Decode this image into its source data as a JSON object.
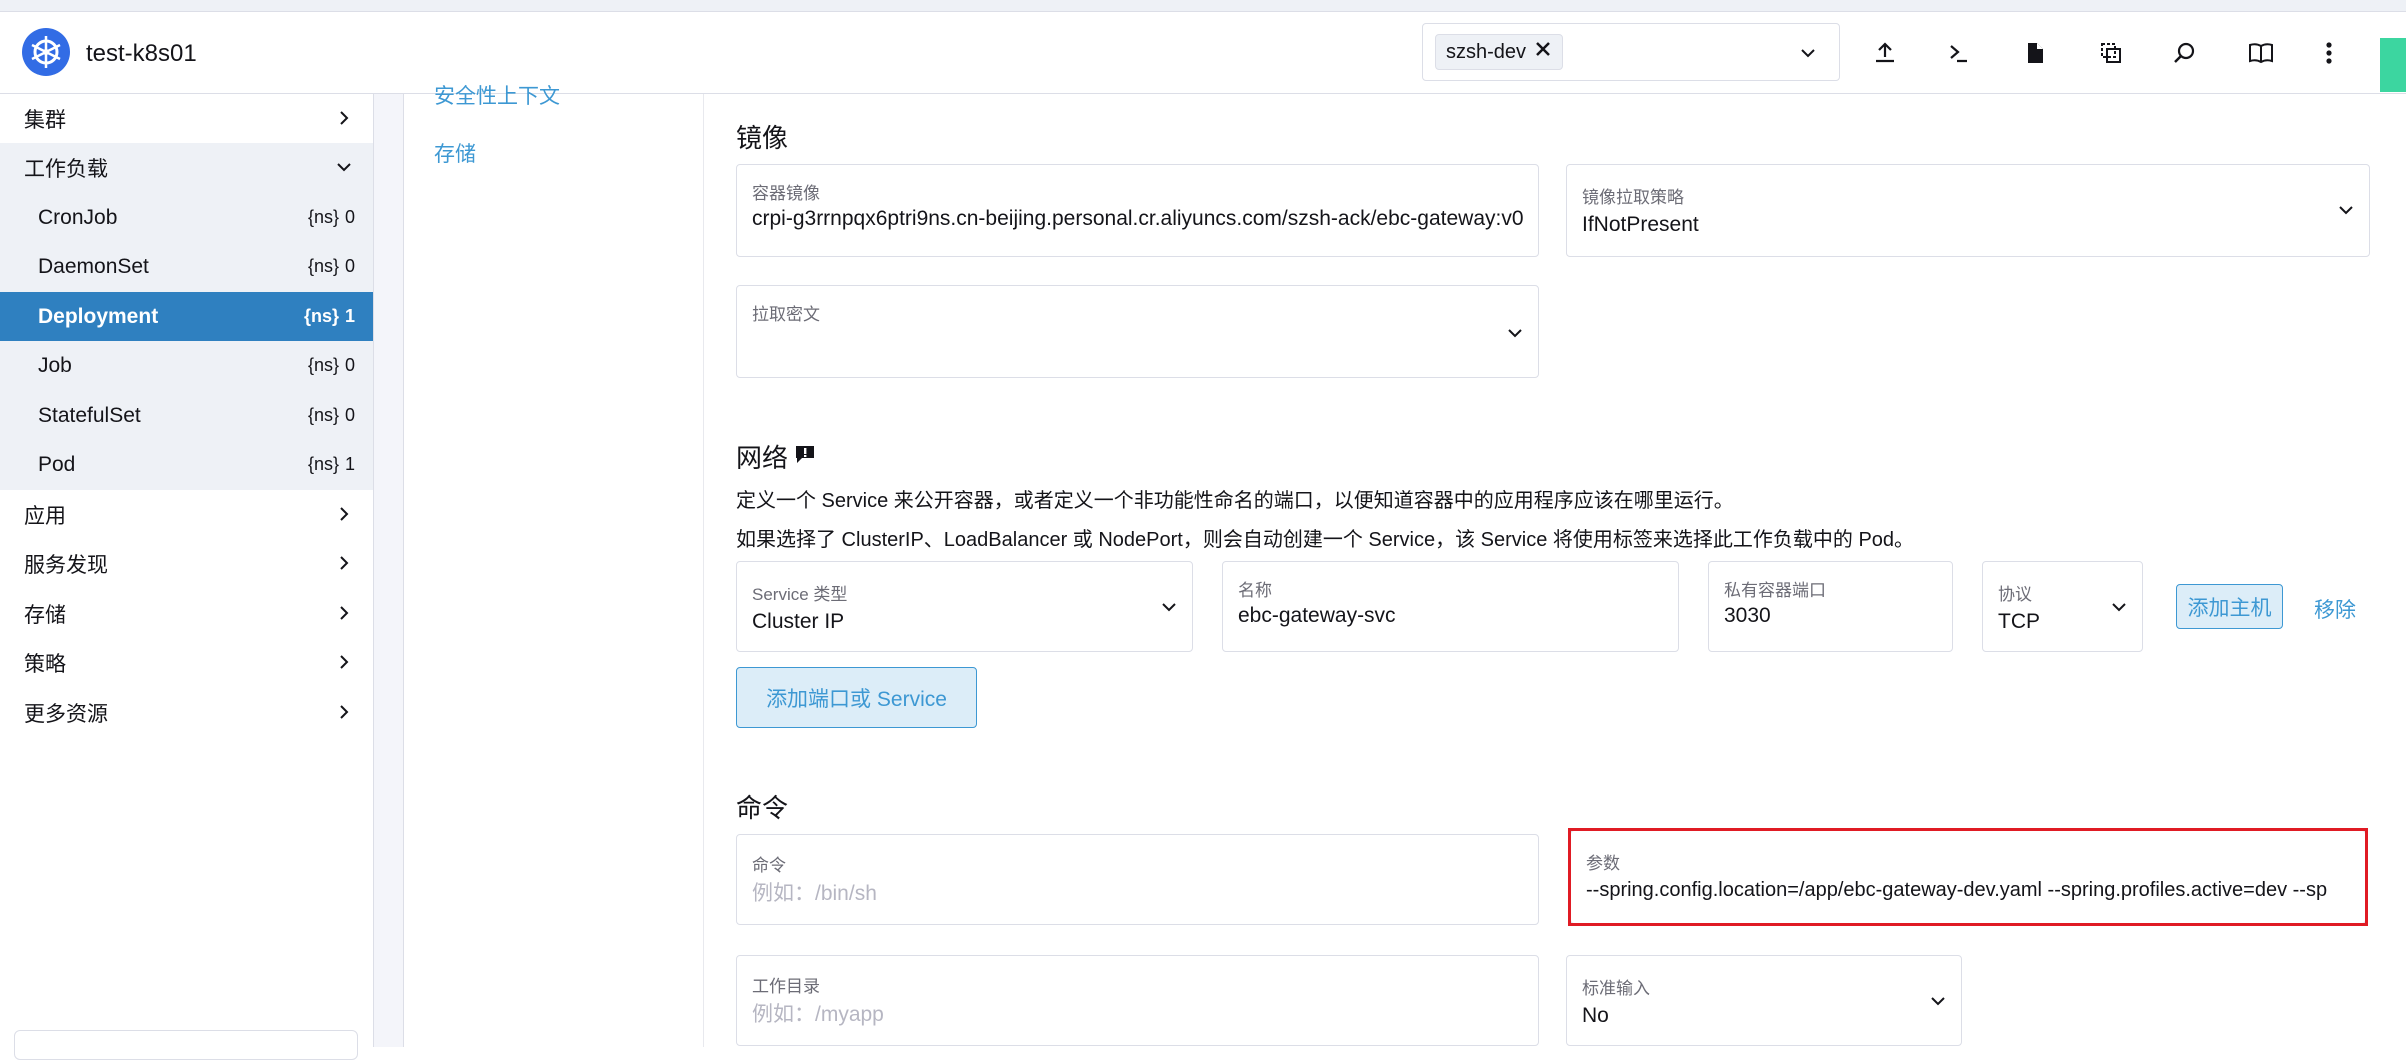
{
  "header": {
    "cluster_name": "test-k8s01",
    "namespace_tag": "szsh-dev"
  },
  "sidebar": {
    "groups": [
      {
        "label": "集群"
      },
      {
        "label": "工作负载"
      },
      {
        "label": "应用"
      },
      {
        "label": "服务发现"
      },
      {
        "label": "存储"
      },
      {
        "label": "策略"
      },
      {
        "label": "更多资源"
      }
    ],
    "workloads": [
      {
        "label": "CronJob",
        "count": "0"
      },
      {
        "label": "DaemonSet",
        "count": "0"
      },
      {
        "label": "Deployment",
        "count": "1"
      },
      {
        "label": "Job",
        "count": "0"
      },
      {
        "label": "StatefulSet",
        "count": "0"
      },
      {
        "label": "Pod",
        "count": "1"
      }
    ]
  },
  "subnav": {
    "partial_link": "安全性上下文",
    "storage_link": "存储"
  },
  "image_section": {
    "title": "镜像",
    "container_image_label": "容器镜像",
    "container_image_value": "crpi-g3rrnpqx6ptri9ns.cn-beijing.personal.cr.aliyuncs.com/szsh-ack/ebc-gateway:v0(",
    "pull_policy_label": "镜像拉取策略",
    "pull_policy_value": "IfNotPresent",
    "pull_secret_label": "拉取密文"
  },
  "network_section": {
    "title": "网络",
    "desc1": "定义一个 Service 来公开容器，或者定义一个非功能性命名的端口，以便知道容器中的应用程序应该在哪里运行。",
    "desc2": "如果选择了 ClusterIP、LoadBalancer 或 NodePort，则会自动创建一个 Service，该 Service 将使用标签来选择此工作负载中的 Pod。",
    "service_type_label": "Service 类型",
    "service_type_value": "Cluster IP",
    "name_label": "名称",
    "name_value": "ebc-gateway-svc",
    "port_label": "私有容器端口",
    "port_value": "3030",
    "protocol_label": "协议",
    "protocol_value": "TCP",
    "add_host_button": "添加主机",
    "remove_link": "移除",
    "add_port_button": "添加端口或 Service"
  },
  "command_section": {
    "title": "命令",
    "command_label": "命令",
    "command_placeholder": "例如：/bin/sh",
    "args_label": "参数",
    "args_value": "--spring.config.location=/app/ebc-gateway-dev.yaml  --spring.profiles.active=dev --sp",
    "workdir_label": "工作目录",
    "workdir_placeholder": "例如：/myapp",
    "stdin_label": "标准输入",
    "stdin_value": "No"
  },
  "colors": {
    "accent": "#3d98d3",
    "active_nav": "#2f80c0",
    "highlight": "#e01b24",
    "logo": "#326ce5"
  }
}
